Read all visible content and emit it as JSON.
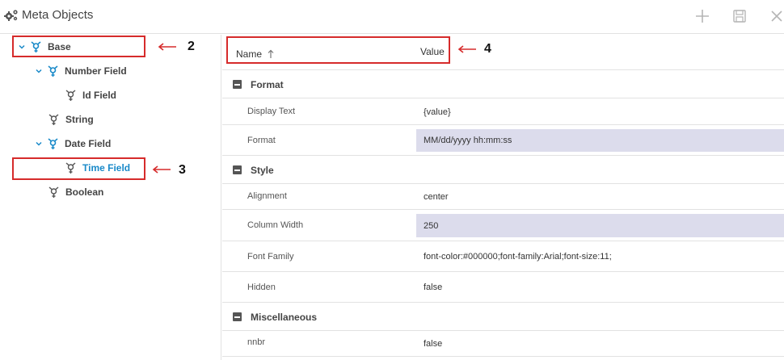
{
  "window": {
    "title": "Meta Objects",
    "icon": "gears-icon",
    "buttons": {
      "add": "plus-icon",
      "save": "save-icon",
      "close": "close-icon"
    }
  },
  "tree": [
    {
      "label": "Base",
      "icon": "node-icon",
      "expanded": true,
      "selected": false
    },
    {
      "label": "Number Field",
      "icon": "node-icon",
      "expanded": true,
      "selected": false
    },
    {
      "label": "Id Field",
      "icon": "leaf-node-icon",
      "selected": false
    },
    {
      "label": "String",
      "icon": "leaf-node-icon",
      "selected": false
    },
    {
      "label": "Date Field",
      "icon": "node-icon",
      "expanded": true,
      "selected": false
    },
    {
      "label": "Time Field",
      "icon": "leaf-node-icon",
      "selected": true
    },
    {
      "label": "Boolean",
      "icon": "leaf-node-icon",
      "selected": false
    }
  ],
  "callouts": {
    "base": "2",
    "time_field": "3",
    "header": "4"
  },
  "grid": {
    "headers": {
      "name": "Name",
      "value": "Value"
    },
    "groups": [
      {
        "label": "Format",
        "rows": [
          {
            "name": "Display Text",
            "value": "{value}"
          },
          {
            "name": "Format",
            "value": "MM/dd/yyyy hh:mm:ss"
          }
        ]
      },
      {
        "label": "Style",
        "rows": [
          {
            "name": "Alignment",
            "value": "center"
          },
          {
            "name": "Column Width",
            "value": "250"
          },
          {
            "name": "Font Family",
            "value": "font-color:#000000;font-family:Arial;font-size:11;"
          },
          {
            "name": "Hidden",
            "value": "false"
          }
        ]
      },
      {
        "label": "Miscellaneous",
        "rows": [
          {
            "name": "nnbr",
            "value": "false"
          }
        ]
      }
    ]
  },
  "colors": {
    "accent": "#1a8ac9",
    "highlight": "#d62b2b",
    "edit_bg": "#dcdcec"
  }
}
